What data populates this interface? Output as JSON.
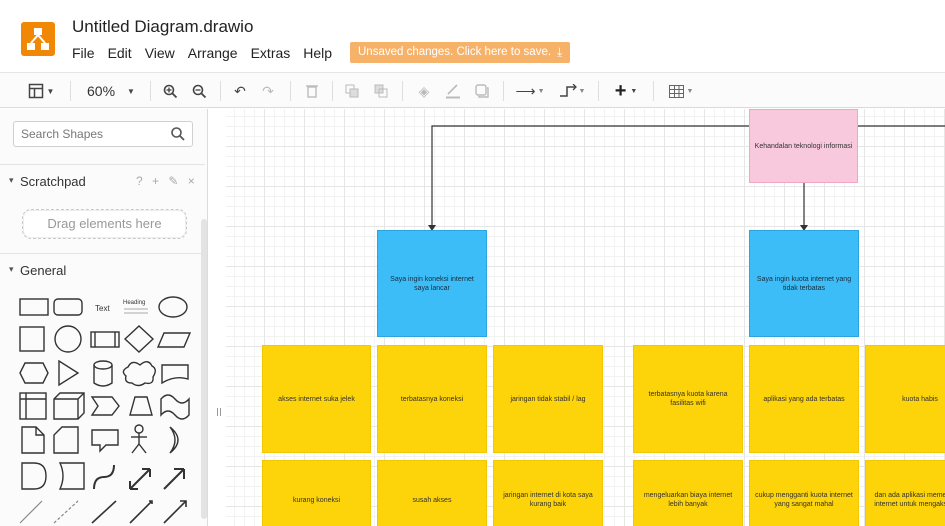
{
  "app": {
    "title": "Untitled Diagram.drawio",
    "menu": [
      "File",
      "Edit",
      "View",
      "Arrange",
      "Extras",
      "Help"
    ],
    "unsaved_notice": "Unsaved changes. Click here to save.",
    "colors": {
      "logo": "#f08705",
      "notice": "#f7b26a"
    }
  },
  "toolbar": {
    "zoom": "60%",
    "icons": [
      "format-panel-icon",
      "zoom-in-icon",
      "zoom-out-icon",
      "undo-icon",
      "redo-icon",
      "delete-icon",
      "to-front-icon",
      "to-back-icon",
      "fill-color-icon",
      "line-color-icon",
      "shadow-icon",
      "connection-icon",
      "waypoints-icon",
      "insert-icon",
      "table-icon"
    ]
  },
  "sidebar": {
    "search_placeholder": "Search Shapes",
    "scratchpad_label": "Scratchpad",
    "scratchpad_icons": "? + ✎ ×",
    "drag_hint": "Drag elements here",
    "general_label": "General",
    "text_shape_label": "Text",
    "heading_shape_label": "Heading"
  },
  "diagram": {
    "root": "Kehandalan teknologi informasi",
    "blue_left": "Saya ingin koneksi internet saya lancar",
    "blue_right": "Saya ingin kuota internet yang tidak terbatas",
    "yellow_row1": [
      "akses internet suka jelek",
      "terbatasnya koneksi",
      "jaringan tidak stabil / lag",
      "terbatasnya kuota karena fasilitas wifi",
      "aplikasi yang ada terbatas",
      "kuota habis"
    ],
    "yellow_row2": [
      "kurang koneksi",
      "susah akses",
      "jaringan internet di kota saya kurang baik",
      "mengeluarkan biaya internet lebih banyak",
      "cukup mengganti kuota internet yang sangat mahal",
      "dan ada aplikasi memerlukan internet untuk mengaksesnya"
    ]
  }
}
